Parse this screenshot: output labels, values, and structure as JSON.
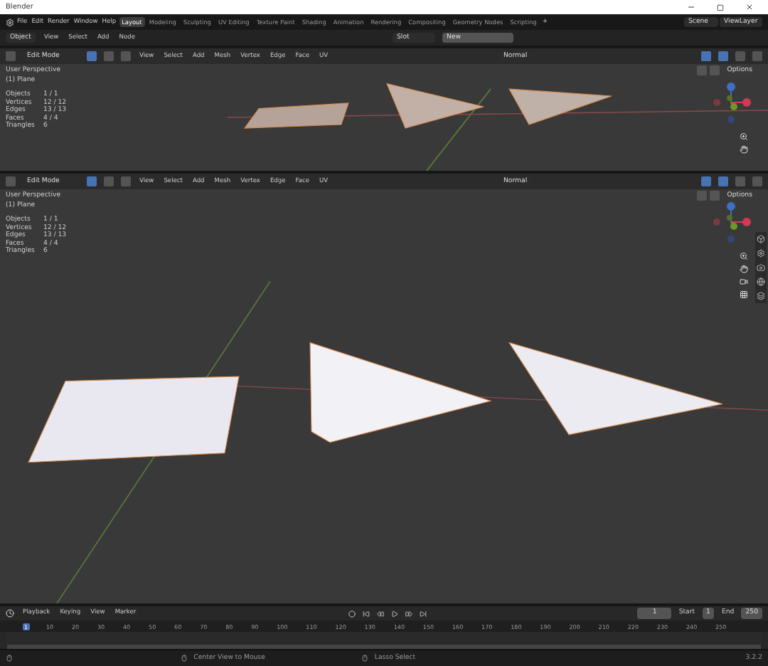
{
  "window": {
    "title": "Blender"
  },
  "menu": [
    "File",
    "Edit",
    "Render",
    "Window",
    "Help"
  ],
  "workspaces": [
    {
      "label": "Layout",
      "selected": true
    },
    {
      "label": "Modeling",
      "selected": false
    },
    {
      "label": "Sculpting",
      "selected": false
    },
    {
      "label": "UV Editing",
      "selected": false
    },
    {
      "label": "Texture Paint",
      "selected": false
    },
    {
      "label": "Shading",
      "selected": false
    },
    {
      "label": "Animation",
      "selected": false
    },
    {
      "label": "Rendering",
      "selected": false
    },
    {
      "label": "Compositing",
      "selected": false
    },
    {
      "label": "Geometry Nodes",
      "selected": false
    },
    {
      "label": "Scripting",
      "selected": false
    }
  ],
  "add_workspace": "+",
  "scene": "Scene",
  "view_layer": "ViewLayer",
  "editor_header": {
    "mode": "Object",
    "menus": [
      "View",
      "Select",
      "Add",
      "Node"
    ],
    "slot": "Slot",
    "new_button": "New"
  },
  "viewports": [
    {
      "mode": "Edit Mode",
      "menus": [
        "View",
        "Select",
        "Add",
        "Mesh",
        "Vertex",
        "Edge",
        "Face",
        "UV"
      ],
      "select_modes": [
        {
          "selected": true
        },
        {
          "selected": false
        },
        {
          "selected": false
        }
      ],
      "orientation": "Normal",
      "options": "Options",
      "view_name": "User Perspective",
      "object": "(1) Plane",
      "stats": [
        {
          "label": "Objects",
          "value": "1 / 1"
        },
        {
          "label": "Vertices",
          "value": "12 / 12"
        },
        {
          "label": "Edges",
          "value": "13 / 13"
        },
        {
          "label": "Faces",
          "value": "4 / 4"
        },
        {
          "label": "Triangles",
          "value": "6"
        }
      ]
    },
    {
      "mode": "Edit Mode",
      "menus": [
        "View",
        "Select",
        "Add",
        "Mesh",
        "Vertex",
        "Edge",
        "Face",
        "UV"
      ],
      "select_modes": [
        {
          "selected": true
        },
        {
          "selected": false
        },
        {
          "selected": false
        }
      ],
      "orientation": "Normal",
      "options": "Options",
      "view_name": "User Perspective",
      "object": "(1) Plane",
      "stats": [
        {
          "label": "Objects",
          "value": "1 / 1"
        },
        {
          "label": "Vertices",
          "value": "12 / 12"
        },
        {
          "label": "Edges",
          "value": "13 / 13"
        },
        {
          "label": "Faces",
          "value": "4 / 4"
        },
        {
          "label": "Triangles",
          "value": "6"
        }
      ]
    }
  ],
  "timeline": {
    "menus": [
      "Playback",
      "Keying",
      "View",
      "Marker"
    ],
    "current_frame": "1",
    "start_label": "Start",
    "start": "1",
    "end_label": "End",
    "end": "250",
    "ruler": [
      "1",
      "10",
      "20",
      "30",
      "40",
      "50",
      "60",
      "70",
      "80",
      "90",
      "100",
      "110",
      "120",
      "130",
      "140",
      "150",
      "160",
      "170",
      "180",
      "190",
      "200",
      "210",
      "220",
      "230",
      "240",
      "250"
    ]
  },
  "status_bar": {
    "hints": [
      "Center View to Mouse",
      "Lasso Select"
    ],
    "version": "3.2.2"
  }
}
